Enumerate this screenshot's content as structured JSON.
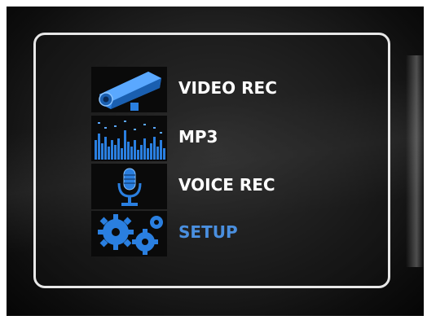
{
  "menu": {
    "items": [
      {
        "label": "VIDEO REC",
        "icon": "camera-icon",
        "active": false
      },
      {
        "label": "MP3",
        "icon": "equalizer-icon",
        "active": false
      },
      {
        "label": "VOICE REC",
        "icon": "microphone-icon",
        "active": false
      },
      {
        "label": "SETUP",
        "icon": "gears-icon",
        "active": true
      }
    ]
  },
  "colors": {
    "label": "#ffffff",
    "active_label": "#4a8fdf",
    "icon_blue": "#2a7fe0",
    "frame": "#e8e8e8"
  }
}
